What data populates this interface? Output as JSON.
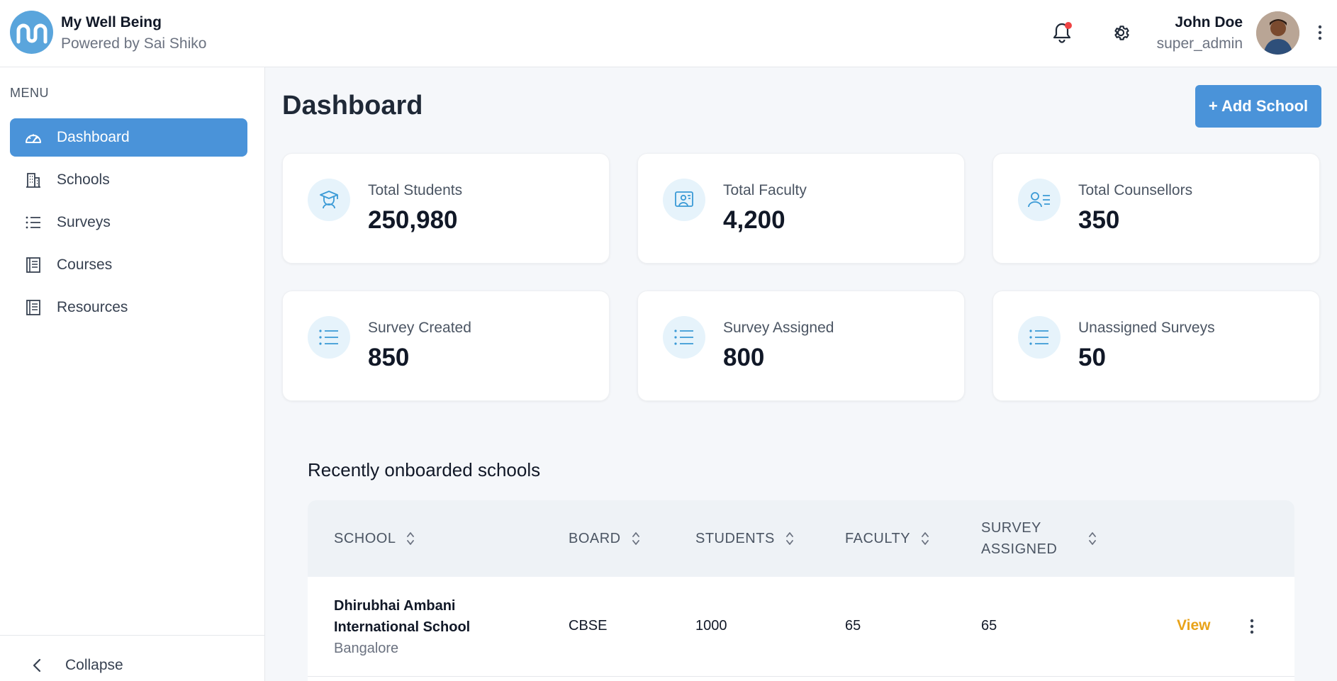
{
  "app": {
    "title": "My Well Being",
    "subtitle": "Powered by Sai Shiko"
  },
  "user": {
    "name": "John Doe",
    "role": "super_admin"
  },
  "sidebar": {
    "menu_label": "MENU",
    "items": [
      {
        "label": "Dashboard",
        "icon": "gauge-icon",
        "active": true
      },
      {
        "label": "Schools",
        "icon": "building-icon"
      },
      {
        "label": "Surveys",
        "icon": "list-icon"
      },
      {
        "label": "Courses",
        "icon": "document-icon"
      },
      {
        "label": "Resources",
        "icon": "document-icon"
      }
    ],
    "collapse_label": "Collapse"
  },
  "page": {
    "title": "Dashboard",
    "add_button": "+ Add School"
  },
  "stats": [
    {
      "label": "Total Students",
      "value": "250,980",
      "icon": "graduate-icon"
    },
    {
      "label": "Total Faculty",
      "value": "4,200",
      "icon": "presentation-icon"
    },
    {
      "label": "Total Counsellors",
      "value": "350",
      "icon": "counsellor-icon"
    },
    {
      "label": "Survey Created",
      "value": "850",
      "icon": "list-icon"
    },
    {
      "label": "Survey Assigned",
      "value": "800",
      "icon": "list-icon"
    },
    {
      "label": "Unassigned Surveys",
      "value": "50",
      "icon": "list-icon"
    }
  ],
  "recent": {
    "title": "Recently onboarded schools",
    "columns": [
      "SCHOOL",
      "BOARD",
      "STUDENTS",
      "FACULTY",
      "SURVEY",
      "ASSIGNED"
    ],
    "rows": [
      {
        "school_line1": "Dhirubhai Ambani",
        "school_line2": "International School",
        "city": "Bangalore",
        "board": "CBSE",
        "students": "1000",
        "faculty": "65",
        "survey_assigned": "65",
        "action": "View"
      }
    ]
  },
  "colors": {
    "primary": "#4a93d9",
    "accent_link": "#e8a319",
    "notification": "#ef4444",
    "icon_bg": "#e6f3fb",
    "icon_stroke": "#3a9ad6"
  }
}
